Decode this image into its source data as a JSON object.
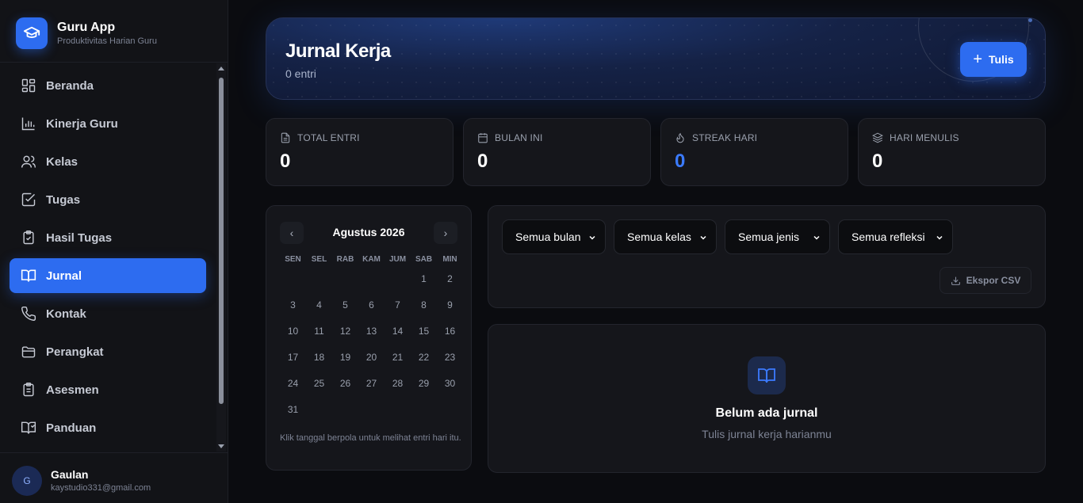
{
  "brand": {
    "title": "Guru App",
    "subtitle": "Produktivitas Harian Guru",
    "icon": "graduation-cap-icon"
  },
  "sidebar": {
    "items": [
      {
        "label": "Beranda",
        "icon": "grid-icon",
        "active": false
      },
      {
        "label": "Kinerja Guru",
        "icon": "bar-chart-icon",
        "active": false
      },
      {
        "label": "Kelas",
        "icon": "users-icon",
        "active": false
      },
      {
        "label": "Tugas",
        "icon": "check-square-icon",
        "active": false
      },
      {
        "label": "Hasil Tugas",
        "icon": "clipboard-check-icon",
        "active": false
      },
      {
        "label": "Jurnal",
        "icon": "book-open-icon",
        "active": true
      },
      {
        "label": "Kontak",
        "icon": "phone-icon",
        "active": false
      },
      {
        "label": "Perangkat",
        "icon": "folder-icon",
        "active": false
      },
      {
        "label": "Asesmen",
        "icon": "clipboard-list-icon",
        "active": false
      },
      {
        "label": "Panduan",
        "icon": "book-help-icon",
        "active": false
      }
    ]
  },
  "user": {
    "initial": "G",
    "name": "Gaulan",
    "email": "kaystudio331@gmail.com"
  },
  "header": {
    "title": "Jurnal Kerja",
    "count": "0 entri",
    "write_label": "Tulis"
  },
  "stats": [
    {
      "label": "TOTAL ENTRI",
      "value": "0",
      "icon": "file-text-icon"
    },
    {
      "label": "BULAN INI",
      "value": "0",
      "icon": "calendar-icon"
    },
    {
      "label": "STREAK HARI",
      "value": "0",
      "icon": "flame-icon",
      "accent": "#3b7bff"
    },
    {
      "label": "HARI MENULIS",
      "value": "0",
      "icon": "layers-icon"
    }
  ],
  "calendar": {
    "month": "Agustus 2026",
    "prev": "‹",
    "next": "›",
    "weekdays": [
      "SEN",
      "SEL",
      "RAB",
      "KAM",
      "JUM",
      "SAB",
      "MIN"
    ],
    "days": [
      "",
      "",
      "",
      "",
      "",
      "1",
      "2",
      "3",
      "4",
      "5",
      "6",
      "7",
      "8",
      "9",
      "10",
      "11",
      "12",
      "13",
      "14",
      "15",
      "16",
      "17",
      "18",
      "19",
      "20",
      "21",
      "22",
      "23",
      "24",
      "25",
      "26",
      "27",
      "28",
      "29",
      "30",
      "31"
    ],
    "note": "Klik tanggal berpola untuk melihat entri hari itu."
  },
  "filters": {
    "month": "Semua bulan",
    "class": "Semua kelas",
    "type": "Semua jenis",
    "reflection": "Semua refleksi",
    "export_label": "Ekspor CSV"
  },
  "empty": {
    "title": "Belum ada jurnal",
    "subtitle": "Tulis jurnal kerja harianmu",
    "icon": "book-open-icon"
  },
  "colors": {
    "accent": "#2d6cf0",
    "background": "#0b0c10",
    "panel": "#15161b"
  }
}
